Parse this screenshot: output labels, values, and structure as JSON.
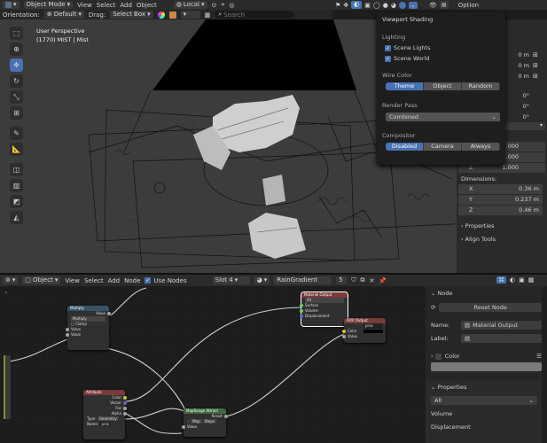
{
  "viewport_header": {
    "editor_icon": "object-mode-icon",
    "mode": "Object Mode",
    "menus": [
      "View",
      "Select",
      "Add",
      "Object"
    ],
    "transform_space": "Local",
    "search_placeholder": "Search",
    "options": "Option"
  },
  "tool_header": {
    "orientation_label": "Orientation:",
    "orientation_value": "Default",
    "drag_label": "Drag:",
    "drag_value": "Select Box"
  },
  "viewport_info": {
    "line1": "User Perspective",
    "line2": "(1770) MIST | Mist"
  },
  "tools": [
    "select-box-icon",
    "cursor-icon",
    "move-icon",
    "rotate-icon",
    "scale-icon",
    "transform-icon",
    "annotate-icon",
    "measure-icon",
    "add-cube-icon",
    "extrude-icon",
    "bevel-icon",
    "knife-icon"
  ],
  "shading_popup": {
    "title": "Viewport Shading",
    "lighting_label": "Lighting",
    "scene_lights": "Scene Lights",
    "scene_world": "Scene World",
    "wire_color_label": "Wire Color",
    "wire_color_options": [
      "Theme",
      "Object",
      "Random"
    ],
    "wire_color_selected": "Theme",
    "render_pass_label": "Render Pass",
    "render_pass_value": "Combined",
    "compositor_label": "Compositor",
    "compositor_options": [
      "Disabled",
      "Camera",
      "Always"
    ],
    "compositor_selected": "Disabled"
  },
  "n_panel": {
    "row_values": [
      "0 m",
      "0 m",
      "0 m"
    ],
    "rot_values": [
      "0°",
      "0°",
      "0°"
    ],
    "scale_values": [
      "1.000",
      "1.000",
      "1.000"
    ],
    "scale_z_label": "Z",
    "dimensions_label": "Dimensions:",
    "dimensions": [
      {
        "axis": "X",
        "value": "0.36 m"
      },
      {
        "axis": "Y",
        "value": "0.237 m"
      },
      {
        "axis": "Z",
        "value": "0.46 m"
      }
    ],
    "properties_label": "Properties",
    "align_tools_label": "Align Tools"
  },
  "node_header": {
    "editor_type": "Object",
    "menus": [
      "View",
      "Select",
      "Add",
      "Node"
    ],
    "use_nodes": "Use Nodes",
    "slot": "Slot 4",
    "material": "RainGradient",
    "users": "5"
  },
  "node_panel": {
    "section": "Node",
    "reset_node": "Reset Node",
    "name_label": "Name:",
    "name_value": "Material Output",
    "label_label": "Label:",
    "color_label": "Color",
    "properties_label": "Properties",
    "target_value": "All",
    "outputs": [
      "Volume",
      "Displacement"
    ]
  },
  "nodes": {
    "multiply": {
      "title": "Multiply",
      "out": "Value",
      "mode": "Multiply",
      "clamp": "Clamp",
      "inputs": [
        "Value",
        "Value"
      ]
    },
    "material_output": {
      "title": "Material Output",
      "target": "All",
      "inputs": [
        "Surface",
        "Volume",
        "Displacement"
      ]
    },
    "aov_output": {
      "title": "AOV Output",
      "inputs": [
        "Color",
        "Value"
      ],
      "name": "prox"
    },
    "attribute": {
      "title": "Attribute",
      "outputs": [
        "Color",
        "Vector",
        "Fac",
        "Alpha"
      ],
      "type_label": "Type:",
      "type_value": "Geometry",
      "name_label": "Name:",
      "name_value": "prox"
    },
    "map_range": {
      "title": "MapRange Attract",
      "result": "Result",
      "method": "Map",
      "steps": "Steps",
      "input": "Value"
    }
  }
}
